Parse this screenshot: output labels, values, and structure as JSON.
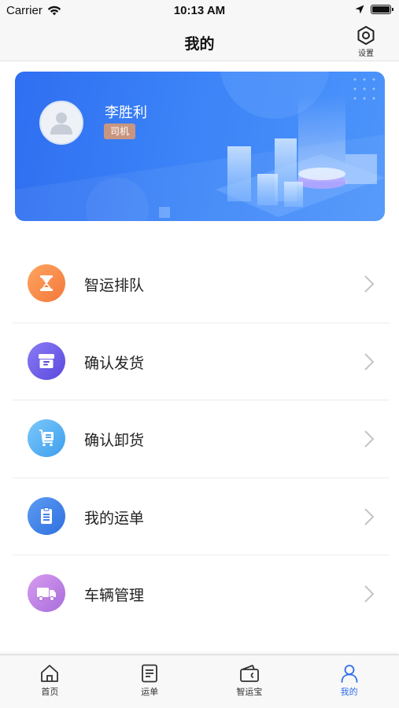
{
  "status_bar": {
    "carrier": "Carrier",
    "time": "10:13 AM"
  },
  "nav": {
    "title": "我的",
    "settings_label": "设置"
  },
  "profile": {
    "name": "李胜利",
    "role": "司机"
  },
  "menu": [
    {
      "label": "智运排队",
      "icon": "hourglass-icon",
      "color": "#f5884a"
    },
    {
      "label": "确认发货",
      "icon": "box-icon",
      "color": "#6b5ce8"
    },
    {
      "label": "确认卸货",
      "icon": "cart-icon",
      "color": "#5ab4f4"
    },
    {
      "label": "我的运单",
      "icon": "clipboard-icon",
      "color": "#3e82ea"
    },
    {
      "label": "车辆管理",
      "icon": "truck-icon",
      "color": "#c084e4"
    }
  ],
  "tabs": [
    {
      "label": "首页",
      "icon": "home-icon"
    },
    {
      "label": "运单",
      "icon": "document-icon"
    },
    {
      "label": "智运宝",
      "icon": "wallet-icon"
    },
    {
      "label": "我的",
      "icon": "person-icon",
      "active": true
    }
  ],
  "accent_color": "#2f6fe8"
}
